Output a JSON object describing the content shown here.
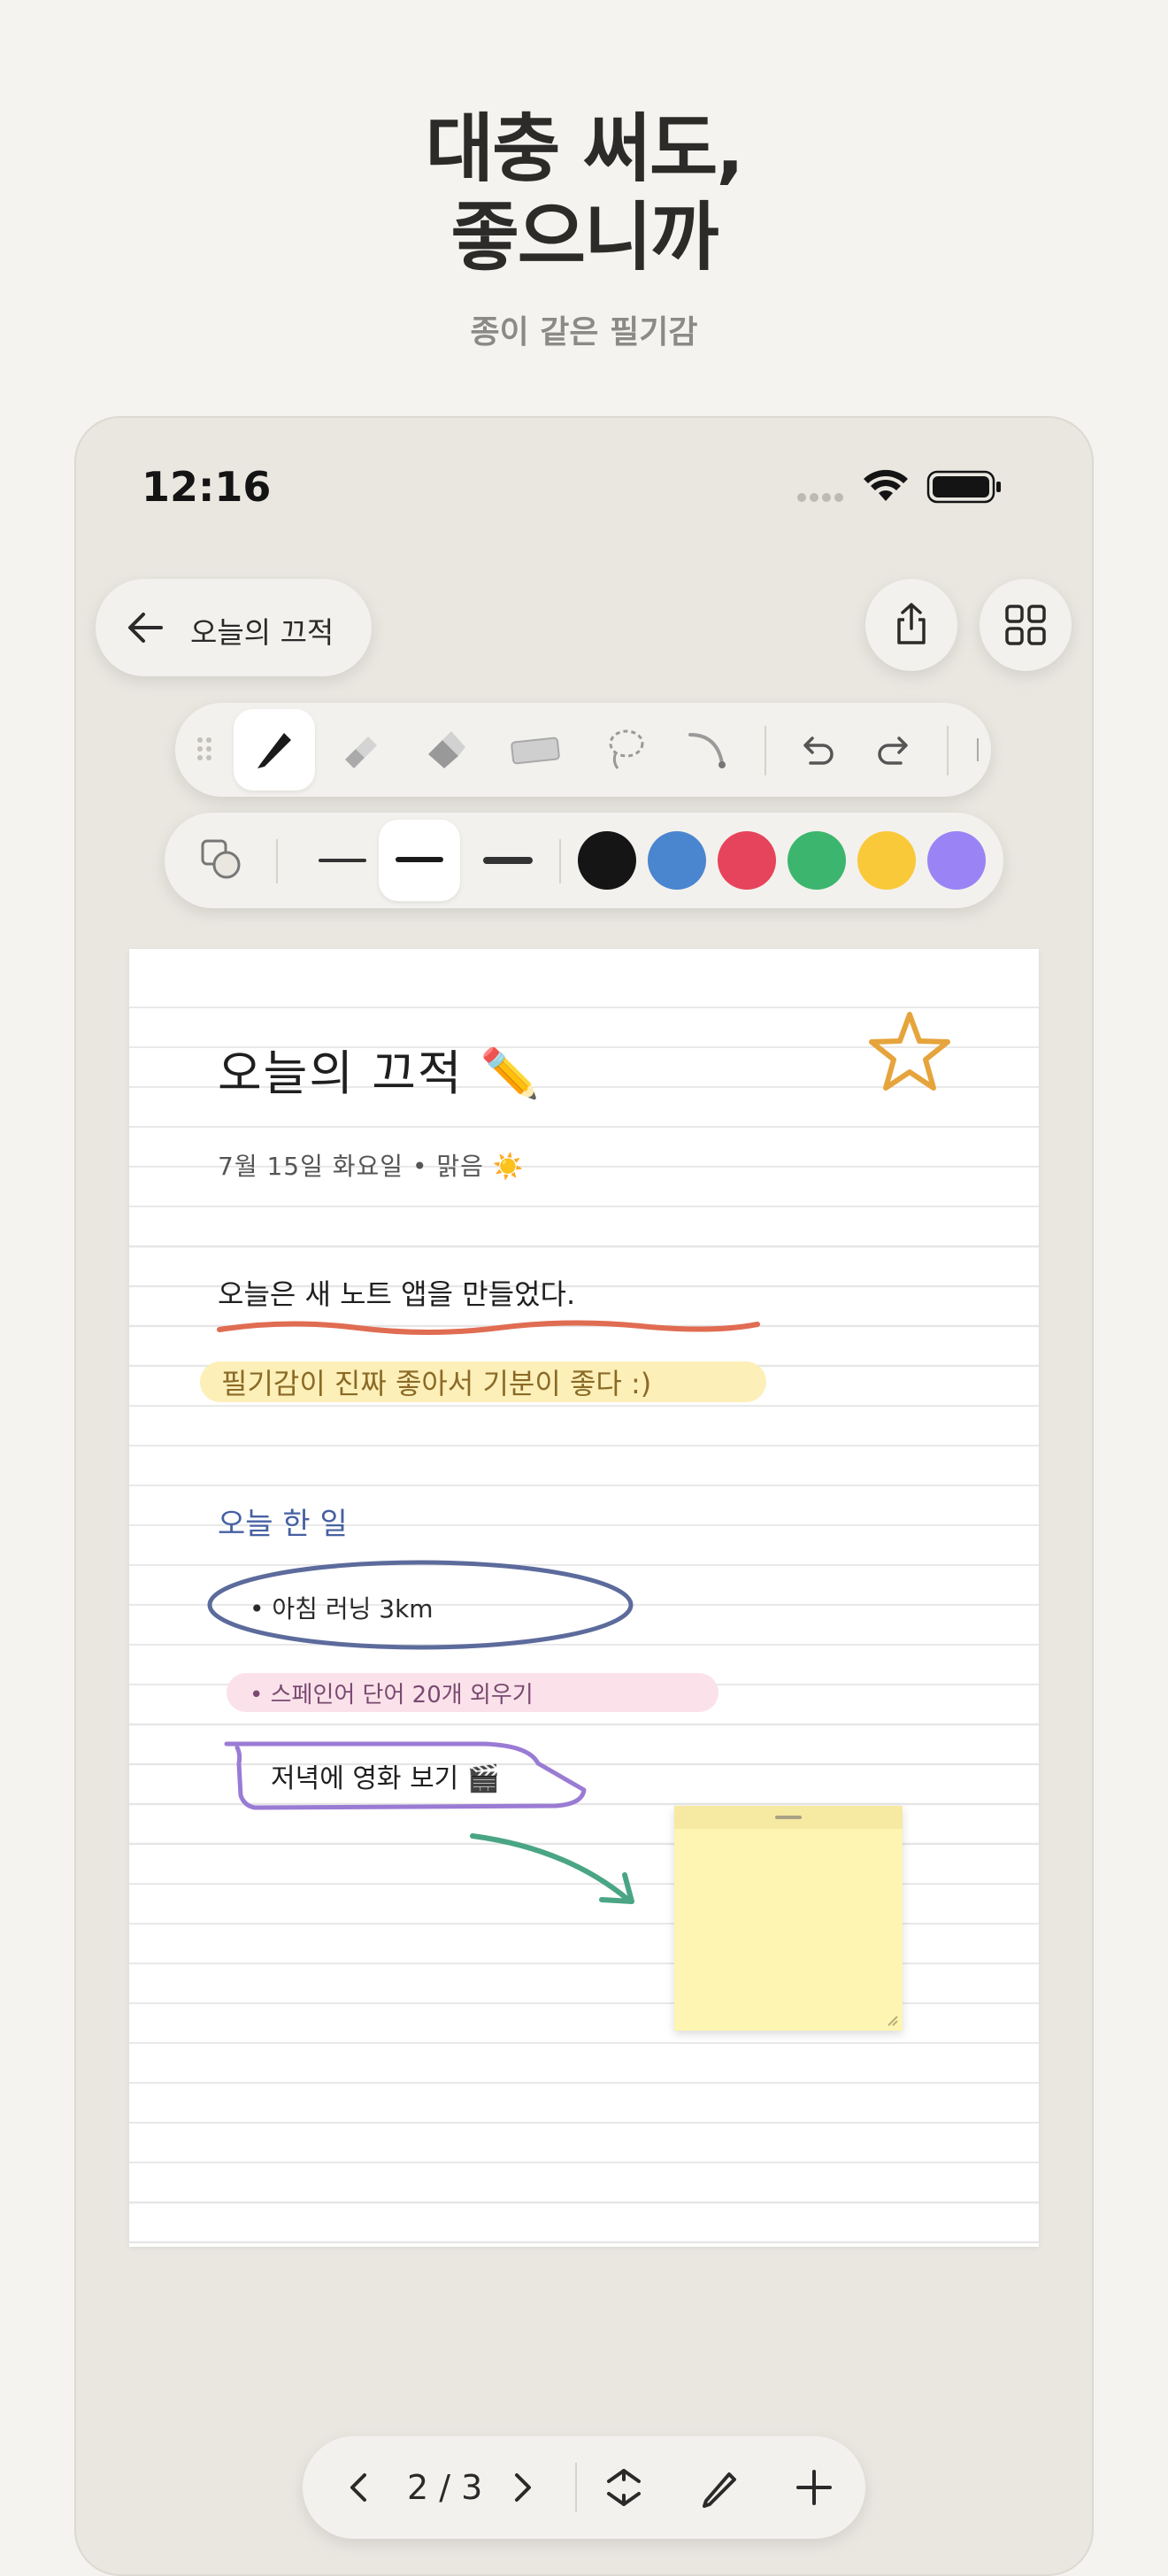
{
  "hero": {
    "title_line1": "대충 써도,",
    "title_line2": "좋으니까",
    "subtitle": "종이 같은 필기감"
  },
  "status_bar": {
    "time": "12:16",
    "icons": [
      "signal-dots-icon",
      "wifi-icon",
      "battery-icon"
    ]
  },
  "nav": {
    "back_label": "오늘의 끄적",
    "back_icon": "arrow-left-icon",
    "share_icon": "share-icon",
    "grid_icon": "grid-icon"
  },
  "tools": {
    "items": [
      "grip-icon",
      "pen-icon",
      "highlighter-icon",
      "eraser-icon",
      "tape-icon",
      "lasso-icon",
      "curve-tool-icon",
      "undo-icon",
      "redo-icon"
    ],
    "selected": "pen-icon"
  },
  "stroke_options": {
    "shape_icon": "shapes-icon",
    "widths": [
      "thin",
      "medium",
      "thick"
    ],
    "selected_width": "medium",
    "colors": [
      "#151515",
      "#4a86d0",
      "#e6445c",
      "#3cb66e",
      "#f9c93a",
      "#9a84f5"
    ]
  },
  "note": {
    "title": "오늘의 끄적 ✏️",
    "date": "7월 15일 화요일  •  맑음 ☀️",
    "line1": "오늘은 새 노트 앱을 만들었다.",
    "line2": "필기감이 진짜 좋아서 기분이 좋다 :)",
    "todo_title": "오늘 한 일",
    "todo_items": [
      "• 아침 러닝 3km",
      "• 스페인어 단어 20개 외우기",
      "저녁에 영화 보기 🎬"
    ],
    "star_icon": "star-icon",
    "colors": {
      "underline": "#e06c52",
      "circle": "#5c6b9c",
      "box": "#9a7bd4",
      "arrow": "#4aa584",
      "star": "#e6a43c"
    }
  },
  "pager": {
    "page_indicator": "2 / 3",
    "icons": [
      "chevron-left-icon",
      "chevron-right-icon",
      "rotate-icon",
      "pencil-icon",
      "plus-icon"
    ]
  }
}
